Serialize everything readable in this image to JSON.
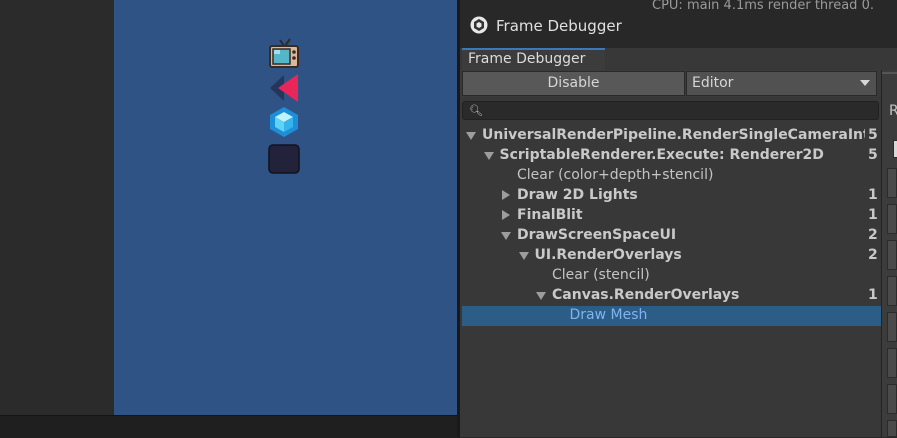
{
  "window": {
    "title": "Frame Debugger",
    "stats_text": "CPU: main 4.1ms  render thread 0.",
    "tab_label": "Frame Debugger"
  },
  "toolbar": {
    "disable_label": "Disable",
    "target_select_value": "Editor"
  },
  "search": {
    "placeholder": ""
  },
  "right_panel": {
    "label_fragment": "R"
  },
  "tree": [
    {
      "label": "UniversalRenderPipeline.RenderSingleCameraInternal",
      "count": "5",
      "depth": 0,
      "expander": "down",
      "bold": true
    },
    {
      "label": "ScriptableRenderer.Execute: Renderer2D",
      "count": "5",
      "depth": 1,
      "expander": "down",
      "bold": true
    },
    {
      "label": "Clear (color+depth+stencil)",
      "count": "",
      "depth": 2,
      "expander": "none",
      "bold": false
    },
    {
      "label": "Draw 2D Lights",
      "count": "1",
      "depth": 2,
      "expander": "right",
      "bold": true
    },
    {
      "label": "FinalBlit",
      "count": "1",
      "depth": 2,
      "expander": "right",
      "bold": true
    },
    {
      "label": "DrawScreenSpaceUI",
      "count": "2",
      "depth": 2,
      "expander": "down",
      "bold": true
    },
    {
      "label": "UI.RenderOverlays",
      "count": "2",
      "depth": 3,
      "expander": "down",
      "bold": true
    },
    {
      "label": "Clear (stencil)",
      "count": "",
      "depth": 4,
      "expander": "none",
      "bold": false
    },
    {
      "label": "Canvas.RenderOverlays",
      "count": "1",
      "depth": 4,
      "expander": "down",
      "bold": true
    },
    {
      "label": "Draw Mesh",
      "count": "",
      "depth": 5,
      "expander": "none",
      "bold": false,
      "selected": true
    }
  ],
  "scene": {
    "icons": [
      "tv-icon",
      "pink-shape-icon",
      "blue-gem-icon",
      "dark-square-icon"
    ]
  },
  "colors": {
    "scene_bg": "#2f5384",
    "selection": "#2c5d87",
    "selected_text": "#7fb4ee",
    "tab_accent": "#3a79bb"
  }
}
